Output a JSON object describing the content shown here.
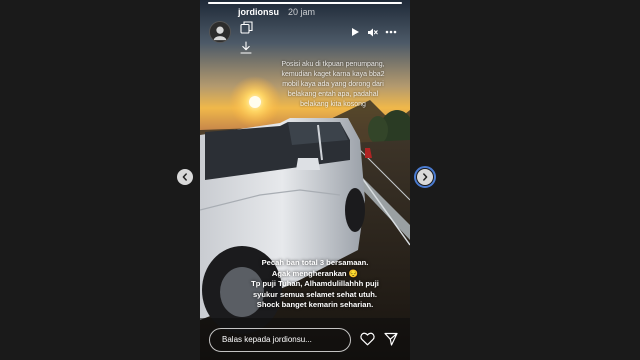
{
  "story": {
    "username": "jordionsu",
    "timestamp": "20 jam",
    "progress_fraction": 1.0,
    "caption_top": "Posisi aku di tkpuan penumpang,\nkemudian kaget karna kaya bba2\nmobil kaya ada yang dorong dari\nbelakang entah apa, padahal\nbelakang kita kosong",
    "caption_bottom": "Pecah ban total 3 bersamaan.\nAgak mengherankan 😔\nTp puji Tuhan, Alhamdulillahhh puji\nsyukur  semua selamet sehat utuh.\nShock banget kemarin seharian.",
    "reply_placeholder": "Balas kepada jordionsu..."
  },
  "icons": {
    "play": "play-icon",
    "mute": "volume-muted-icon",
    "more": "more-icon",
    "copy": "copy-icon",
    "download": "download-icon",
    "like": "heart-icon",
    "share": "send-icon",
    "prev": "chevron-left-icon",
    "next": "chevron-right-icon"
  },
  "colors": {
    "page_background": "#1a1a1a",
    "nav_button": "#d9d9d9",
    "focus_ring": "#4a7bd0",
    "text": "#ffffff"
  }
}
